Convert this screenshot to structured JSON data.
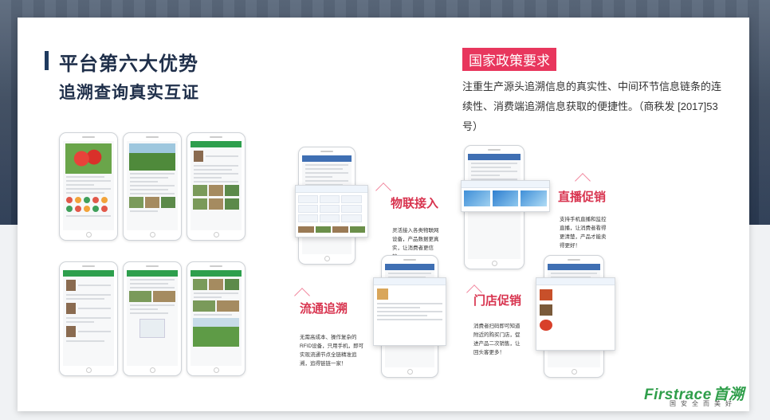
{
  "title": "平台第六大优势",
  "subtitle": "追溯查询真实互证",
  "policy": {
    "tag": "国家政策要求",
    "text": "注重生产源头追溯信息的真实性、中间环节信息链条的连续性、消费端追溯信息获取的便捷性。（商秩发 [2017]53 号）"
  },
  "features": {
    "iot": {
      "title": "物联接入",
      "desc": "灵活接入各类物联网设备，产品数据更真实，让消费者更信赖。"
    },
    "live": {
      "title": "直播促销",
      "desc": "支持手机直播和监控直播，让消费者看得更清楚，产品才能卖得更好！"
    },
    "circulation": {
      "title": "流通追溯",
      "desc": "无需高成本、操作复杂的RFID设备，只用手机，即可实现流通节点全链精准追溯，追得链链一家！"
    },
    "store": {
      "title": "门店促销",
      "desc": "消费者扫码即可知道附近的购买门店，促进产品二次销售，让回头客更多！"
    }
  },
  "logo": {
    "brand": "Firstrace",
    "brand_cn": "首溯",
    "slogan": "国安全而美好"
  },
  "colors": {
    "accent": "#e8365d",
    "navy": "#1f2f4a",
    "brand_green": "#2f9e4a"
  }
}
